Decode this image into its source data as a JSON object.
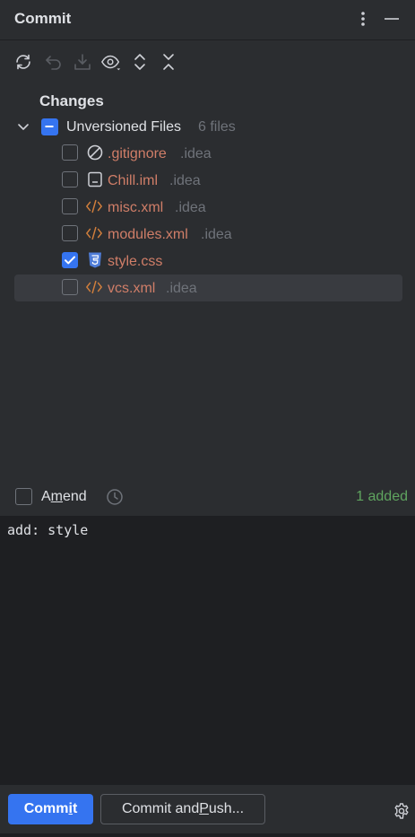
{
  "header": {
    "title": "Commit"
  },
  "toolbar": {
    "buttons": [
      {
        "icon": "refresh-icon"
      },
      {
        "icon": "rollback-icon"
      },
      {
        "icon": "shelve-icon"
      },
      {
        "icon": "show-diff-icon"
      },
      {
        "icon": "expand-all-icon"
      },
      {
        "icon": "collapse-all-icon"
      }
    ]
  },
  "tree": {
    "root_label": "Changes",
    "group": {
      "label": "Unversioned Files",
      "count": "6 files"
    },
    "files": [
      {
        "name": ".gitignore",
        "dir": ".idea",
        "checked": false,
        "icon": "ignore-icon"
      },
      {
        "name": "Chill.iml",
        "dir": ".idea",
        "checked": false,
        "icon": "module-file-icon"
      },
      {
        "name": "misc.xml",
        "dir": ".idea",
        "checked": false,
        "icon": "xml-icon"
      },
      {
        "name": "modules.xml",
        "dir": ".idea",
        "checked": false,
        "icon": "xml-icon"
      },
      {
        "name": "style.css",
        "dir": "",
        "checked": true,
        "icon": "css-icon"
      },
      {
        "name": "vcs.xml",
        "dir": ".idea",
        "checked": false,
        "icon": "xml-icon",
        "selected": true
      }
    ]
  },
  "amend": {
    "label_pre": "A",
    "label_mnemonic": "m",
    "label_post": "end",
    "status": "1 added"
  },
  "message": {
    "value": "add: style"
  },
  "actions": {
    "commit_pre": "Comm",
    "commit_mnemonic": "i",
    "commit_post": "t",
    "push_pre": "Commit and ",
    "push_mnemonic": "P",
    "push_post": "ush..."
  },
  "colors": {
    "accent": "#3574f0",
    "unversioned": "#d07e68",
    "added": "#5fa45f",
    "panel_bg": "#2b2d30",
    "editor_bg": "#1e1f22"
  }
}
